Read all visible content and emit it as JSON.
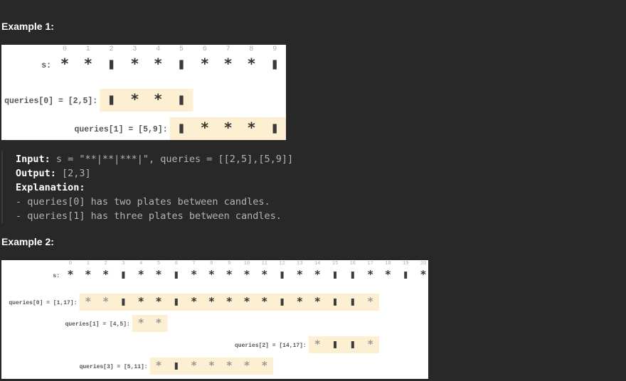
{
  "example1": {
    "heading": "Example 1:",
    "figure": {
      "index_labels": [
        "0",
        "1",
        "2",
        "3",
        "4",
        "5",
        "6",
        "7",
        "8",
        "9"
      ],
      "s_label": "s:",
      "s_symbols": [
        "*",
        "*",
        "|",
        "*",
        "*",
        "|",
        "*",
        "*",
        "*",
        "|"
      ],
      "queries": [
        {
          "label": "queries[0] = [2,5]:",
          "symbols": [
            "|",
            "*",
            "*",
            "|"
          ]
        },
        {
          "label": "queries[1] = [5,9]:",
          "symbols": [
            "|",
            "*",
            "*",
            "*",
            "|"
          ]
        }
      ]
    },
    "code": {
      "input_key": "Input:",
      "input_value": " s = \"**|**|***|\", queries = [[2,5],[5,9]]",
      "output_key": "Output:",
      "output_value": " [2,3]",
      "explanation_key": "Explanation:",
      "explanation_lines": [
        "- queries[0] has two plates between candles.",
        "- queries[1] has three plates between candles."
      ]
    }
  },
  "example2": {
    "heading": "Example 2:",
    "figure": {
      "index_labels": [
        "0",
        "1",
        "2",
        "3",
        "4",
        "5",
        "6",
        "7",
        "8",
        "9",
        "10",
        "11",
        "12",
        "13",
        "14",
        "15",
        "16",
        "17",
        "18",
        "19",
        "20"
      ],
      "s_label": "s:",
      "s_symbols": [
        "*",
        "*",
        "*",
        "|",
        "*",
        "*",
        "|",
        "*",
        "*",
        "*",
        "*",
        "*",
        "|",
        "*",
        "*",
        "|",
        "|",
        "*",
        "*",
        "|",
        "*"
      ],
      "queries": [
        {
          "label": "queries[0] = [1,17]:",
          "symbols": [
            "*",
            "*",
            "|",
            "*",
            "*",
            "|",
            "*",
            "*",
            "*",
            "*",
            "*",
            "|",
            "*",
            "*",
            "|",
            "|",
            "*"
          ],
          "faded": [
            0,
            1,
            16
          ]
        },
        {
          "label": "queries[1] = [4,5]:",
          "symbols": [
            "*",
            "*"
          ],
          "faded": [
            0,
            1
          ]
        },
        {
          "label": "queries[2] = [14,17]:",
          "symbols": [
            "*",
            "|",
            "|",
            "*"
          ],
          "faded": [
            0,
            3
          ]
        },
        {
          "label": "queries[3] = [5,11]:",
          "symbols": [
            "*",
            "|",
            "*",
            "*",
            "*",
            "*",
            "*"
          ],
          "faded": [
            0,
            2,
            3,
            4,
            5,
            6
          ]
        }
      ]
    }
  },
  "colors": {
    "highlight": "#fdf0d2",
    "candle": "#3a3a3a",
    "plate": "#333333",
    "plate_faded": "#999999",
    "index_label": "#b0b0b0"
  }
}
